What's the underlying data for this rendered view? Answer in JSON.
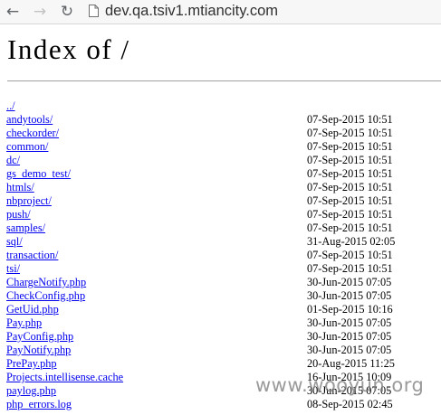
{
  "browser": {
    "url": "dev.qa.tsiv1.mtiancity.com",
    "back_icon": "back-arrow-icon",
    "forward_icon": "forward-arrow-icon",
    "reload_icon": "reload-icon",
    "page_icon": "page-icon"
  },
  "page": {
    "title": "Index of /",
    "entries": [
      {
        "name": "../",
        "date": ""
      },
      {
        "name": "andytools/",
        "date": "07-Sep-2015 10:51"
      },
      {
        "name": "checkorder/",
        "date": "07-Sep-2015 10:51"
      },
      {
        "name": "common/",
        "date": "07-Sep-2015 10:51"
      },
      {
        "name": "dc/",
        "date": "07-Sep-2015 10:51"
      },
      {
        "name": "gs_demo_test/",
        "date": "07-Sep-2015 10:51"
      },
      {
        "name": "htmls/",
        "date": "07-Sep-2015 10:51"
      },
      {
        "name": "nbproject/",
        "date": "07-Sep-2015 10:51"
      },
      {
        "name": "push/",
        "date": "07-Sep-2015 10:51"
      },
      {
        "name": "samples/",
        "date": "07-Sep-2015 10:51"
      },
      {
        "name": "sql/",
        "date": "31-Aug-2015 02:05"
      },
      {
        "name": "transaction/",
        "date": "07-Sep-2015 10:51"
      },
      {
        "name": "tsi/",
        "date": "07-Sep-2015 10:51"
      },
      {
        "name": "ChargeNotify.php",
        "date": "30-Jun-2015 07:05"
      },
      {
        "name": "CheckConfig.php",
        "date": "30-Jun-2015 07:05"
      },
      {
        "name": "GetUid.php",
        "date": "01-Sep-2015 10:16"
      },
      {
        "name": "Pay.php",
        "date": "30-Jun-2015 07:05"
      },
      {
        "name": "PayConfig.php",
        "date": "30-Jun-2015 07:05"
      },
      {
        "name": "PayNotify.php",
        "date": "30-Jun-2015 07:05"
      },
      {
        "name": "PrePay.php",
        "date": "20-Aug-2015 11:25"
      },
      {
        "name": "Projects.intellisense.cache",
        "date": "16-Jun-2015 10:09"
      },
      {
        "name": "paylog.php",
        "date": "30-Jun-2015 07:05"
      },
      {
        "name": "php_errors.log",
        "date": "08-Sep-2015 02:45"
      }
    ]
  },
  "watermark": "www.wooyun.org"
}
